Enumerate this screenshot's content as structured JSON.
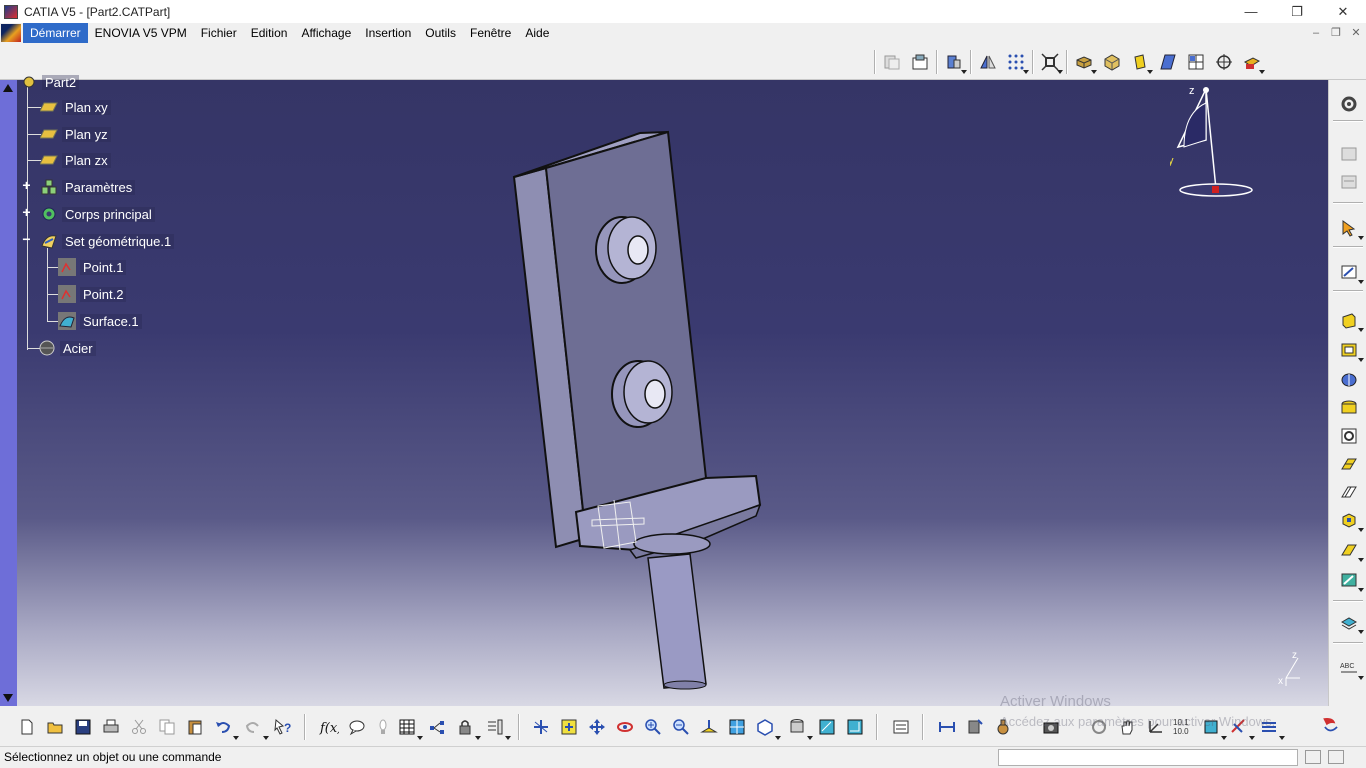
{
  "window": {
    "title": "CATIA V5 - [Part2.CATPart]",
    "controls": {
      "minimize": "—",
      "restore": "❐",
      "close": "✕"
    }
  },
  "menubar": {
    "items": [
      {
        "label": "Démarrer",
        "active": true
      },
      {
        "label": "ENOVIA V5 VPM"
      },
      {
        "label": "Fichier"
      },
      {
        "label": "Edition"
      },
      {
        "label": "Affichage"
      },
      {
        "label": "Insertion"
      },
      {
        "label": "Outils"
      },
      {
        "label": "Fenêtre"
      },
      {
        "label": "Aide"
      }
    ],
    "mdi": {
      "minimize": "–",
      "restore": "❐",
      "close": "✕"
    }
  },
  "tree": {
    "root": "Part2",
    "nodes": [
      {
        "label": "Plan xy",
        "icon": "plane-icon"
      },
      {
        "label": "Plan yz",
        "icon": "plane-icon"
      },
      {
        "label": "Plan zx",
        "icon": "plane-icon"
      },
      {
        "label": "Paramètres",
        "icon": "parameters-icon"
      },
      {
        "label": "Corps principal",
        "icon": "gear-body-icon"
      },
      {
        "label": "Set géométrique.1",
        "icon": "geometrical-set-icon"
      },
      {
        "label": "Point.1",
        "icon": "point-icon"
      },
      {
        "label": "Point.2",
        "icon": "point-icon"
      },
      {
        "label": "Surface.1",
        "icon": "surface-icon"
      },
      {
        "label": "Acier",
        "icon": "material-sphere-icon"
      }
    ]
  },
  "compass": {
    "x": "x",
    "y": "y",
    "z": "z"
  },
  "axis_triad": {
    "z": "z",
    "x": "x"
  },
  "watermark": {
    "line1": "Activer Windows",
    "line2": "Accédez aux paramètres pour activer Windows."
  },
  "status": {
    "message": "Sélectionnez un objet ou une commande",
    "command_value": ""
  },
  "toolbar_labels": {
    "scale": "10.1\n10.0"
  },
  "colors": {
    "menu_active": "#2f6bc9",
    "viewport_top": "#353566",
    "viewport_bottom": "#d8d8e4",
    "part_face": "#7a7aa0"
  }
}
